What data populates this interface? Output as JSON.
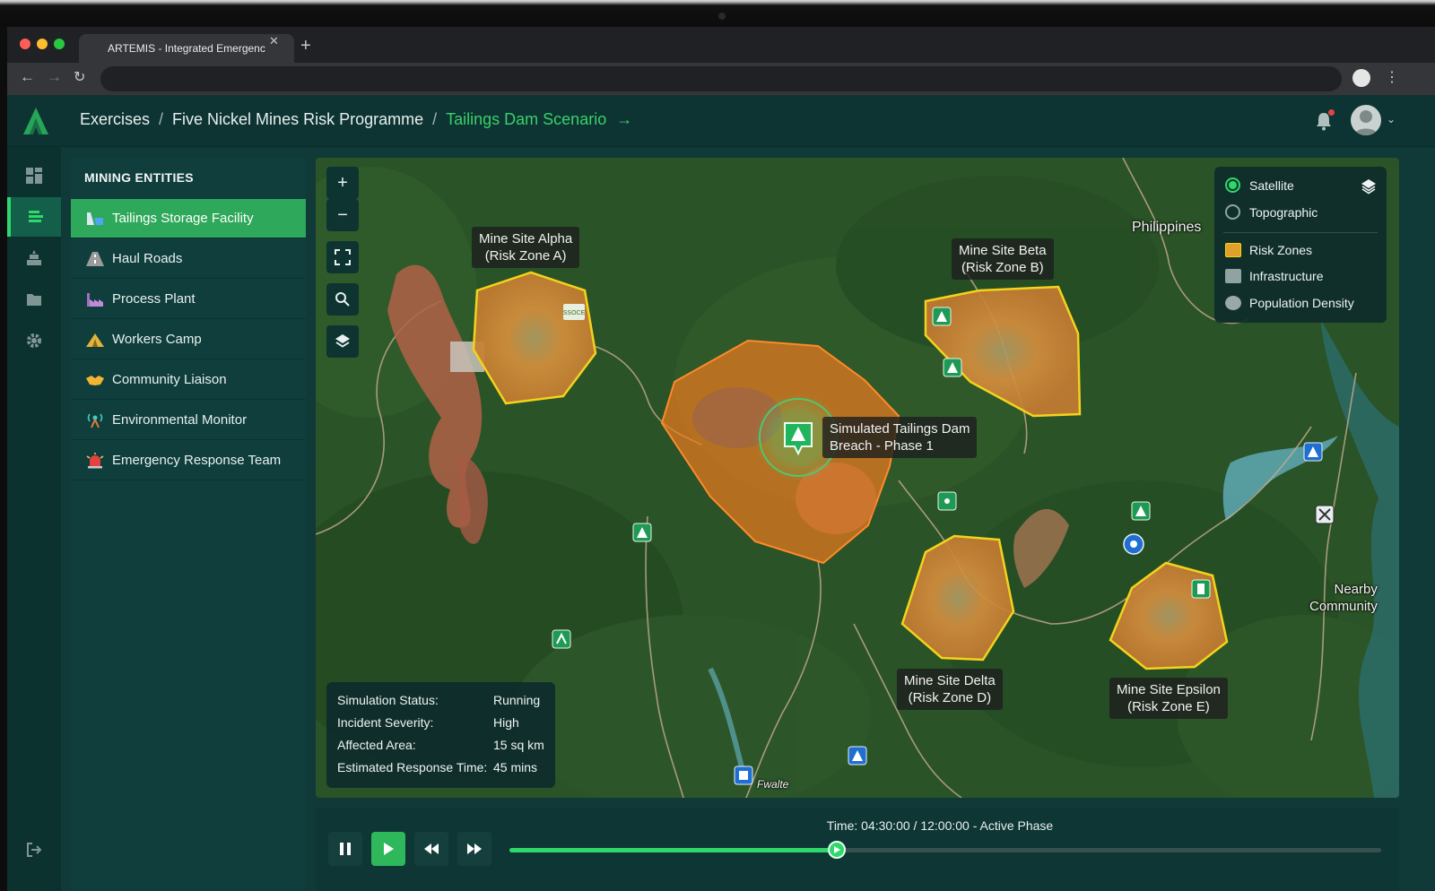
{
  "browser": {
    "tab_title": "ARTEMIS - Integrated Emergenc",
    "tab_close": "✕",
    "new_tab": "+"
  },
  "header": {
    "breadcrumbs": [
      "Exercises",
      "Five Nickel Mines Risk Programme",
      "Tailings Dam Scenario"
    ],
    "separator": "/",
    "active_arrow": "→"
  },
  "sidebar": {
    "title": "MINING ENTITIES",
    "items": [
      {
        "label": "Tailings Storage Facility",
        "icon": "dam-icon",
        "active": true
      },
      {
        "label": "Haul Roads",
        "icon": "road-icon",
        "active": false
      },
      {
        "label": "Process Plant",
        "icon": "factory-icon",
        "active": false
      },
      {
        "label": "Workers Camp",
        "icon": "tent-icon",
        "active": false
      },
      {
        "label": "Community Liaison",
        "icon": "handshake-icon",
        "active": false
      },
      {
        "label": "Environmental Monitor",
        "icon": "antenna-icon",
        "active": false
      },
      {
        "label": "Emergency Response Team",
        "icon": "siren-icon",
        "active": false
      }
    ]
  },
  "rail": [
    "dashboard-icon",
    "entities-icon",
    "stack-icon",
    "folder-icon",
    "gear-icon",
    "logout-icon"
  ],
  "map": {
    "controls": [
      "+",
      "−"
    ],
    "layers": {
      "base": [
        {
          "label": "Satellite",
          "selected": true
        },
        {
          "label": "Topographic",
          "selected": false
        }
      ],
      "overlays": [
        "Risk Zones",
        "Infrastructure",
        "Population Density"
      ]
    },
    "zones": {
      "alpha": [
        "Mine Site Alpha",
        "(Risk Zone A)"
      ],
      "beta": [
        "Mine Site Beta",
        "(Risk Zone B)"
      ],
      "delta": [
        "Mine Site Delta",
        "(Risk Zone D)"
      ],
      "epsilon": [
        "Mine Site Epsilon",
        "(Risk Zone E)"
      ]
    },
    "breach_label": [
      "Simulated Tailings Dam",
      "Breach - Phase 1"
    ],
    "place_labels": {
      "philippines": "Philippines",
      "community": [
        "Nearby",
        "Community"
      ],
      "fwalte": "Fwalte",
      "sign": "SSOCE"
    },
    "status": [
      {
        "key": "Simulation Status:",
        "value": "Running"
      },
      {
        "key": "Incident Severity:",
        "value": "High"
      },
      {
        "key": "Affected Area:",
        "value": "15 sq km"
      },
      {
        "key": "Estimated Response Time:",
        "value": "45 mins"
      }
    ]
  },
  "player": {
    "time_text": "Time: 04:30:00 / 12:00:00 - Active Phase",
    "progress": 0.375
  },
  "colors": {
    "accent": "#2fd86a",
    "zone_orange": "#f07a1e",
    "zone_yellow": "#f5d31c"
  }
}
